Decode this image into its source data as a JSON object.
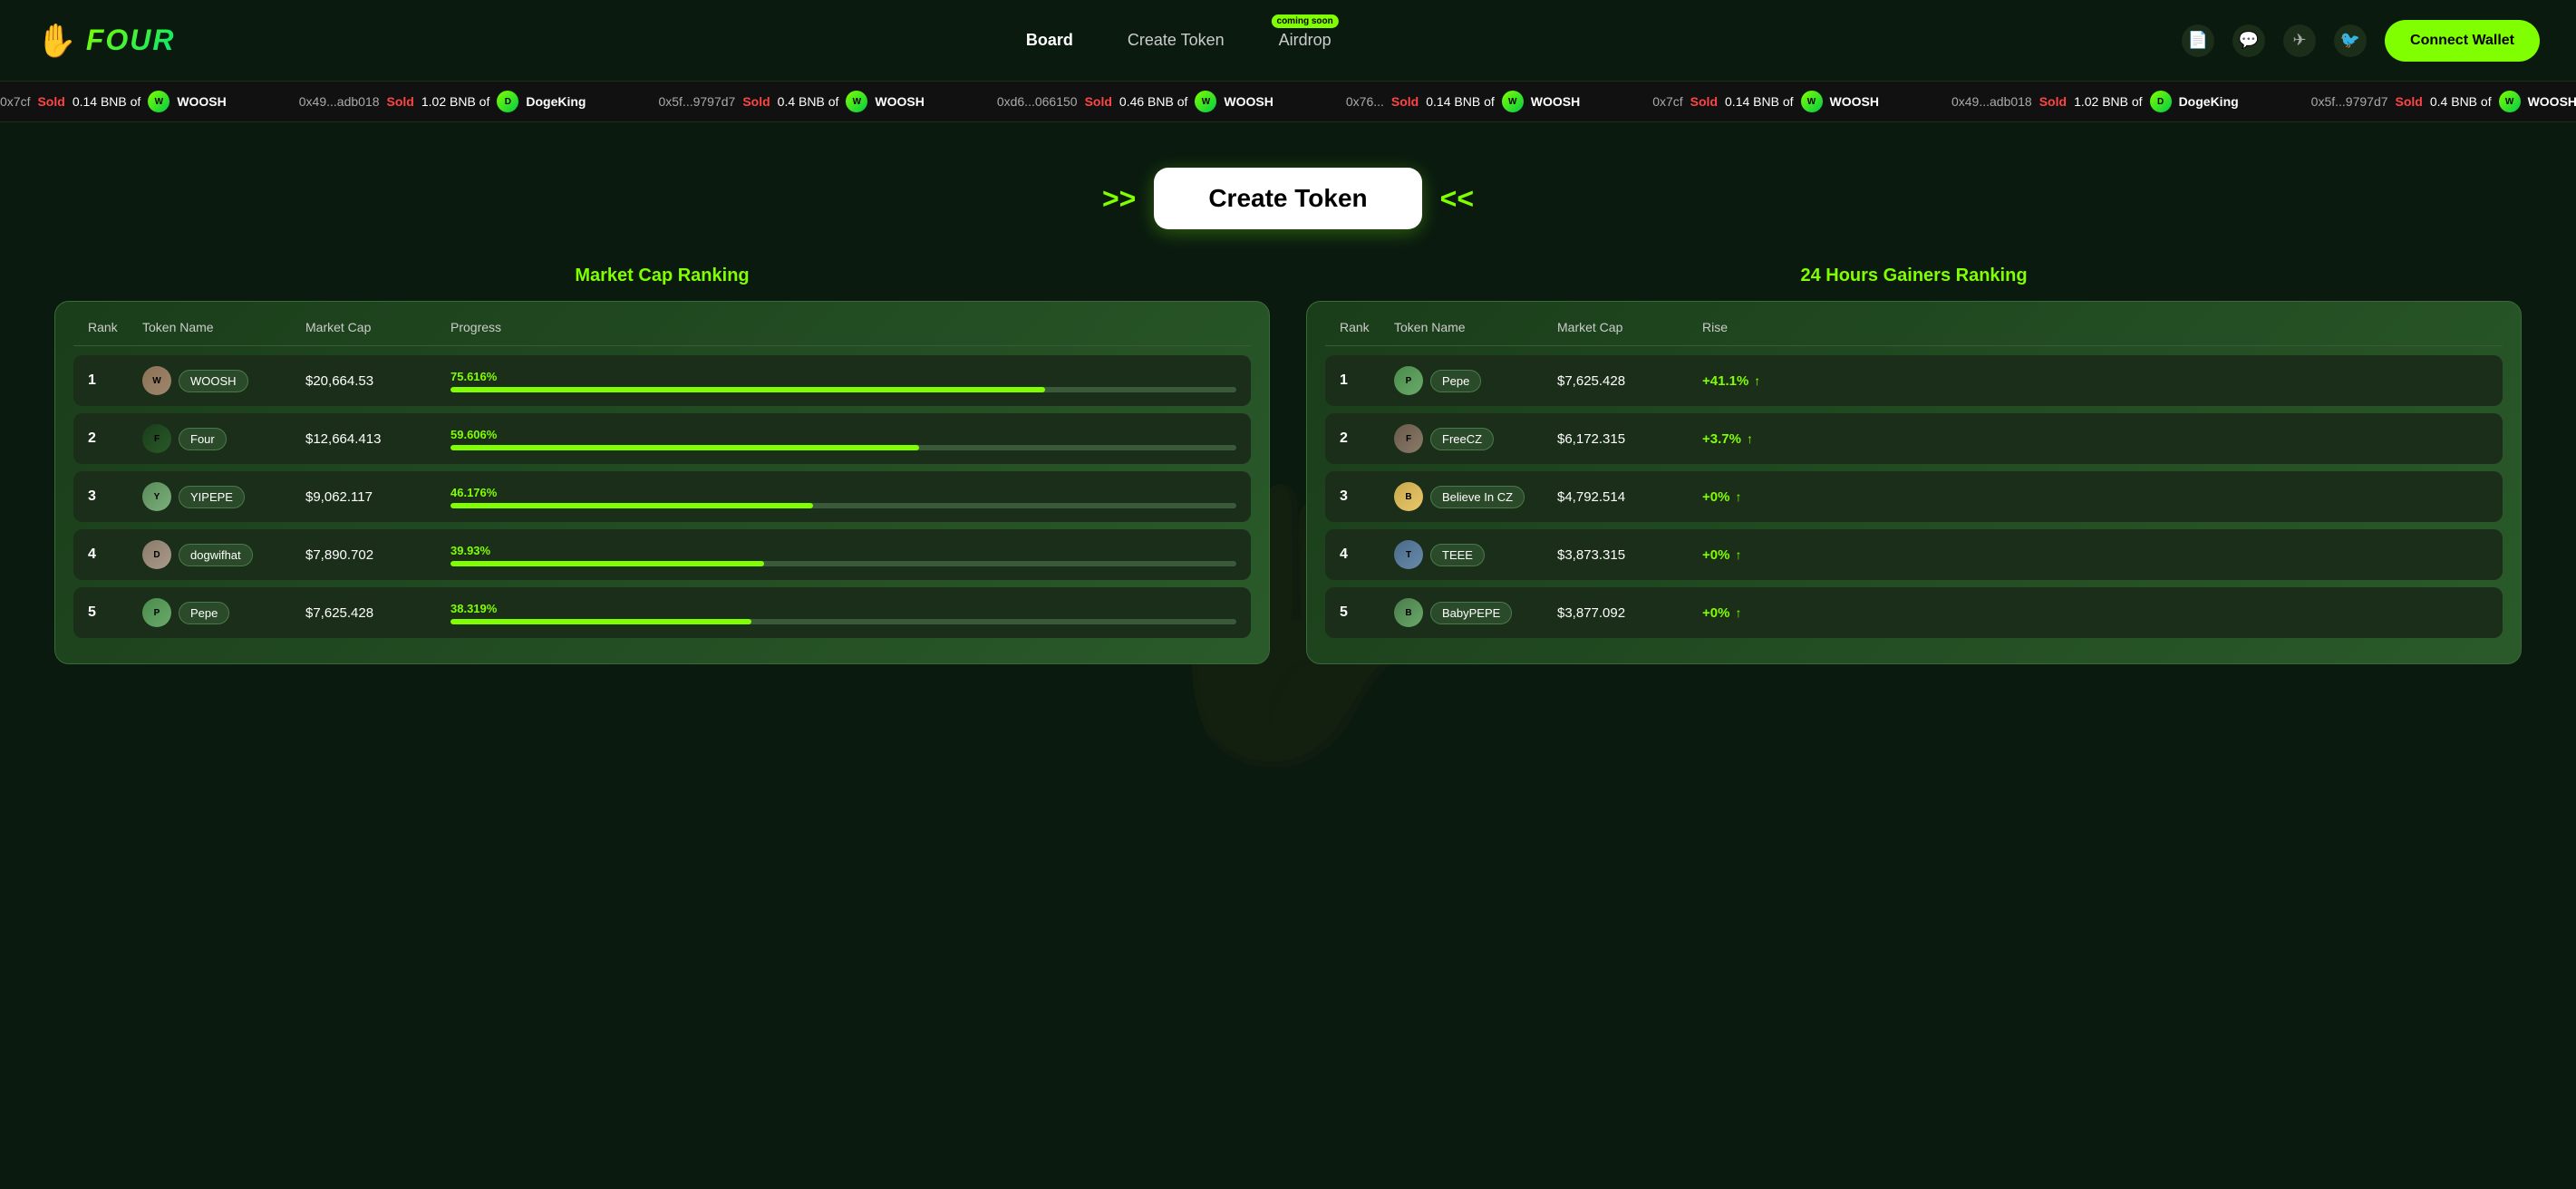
{
  "navbar": {
    "logo_icon": "✋",
    "logo_text": "FOUR",
    "nav_links": [
      {
        "id": "board",
        "label": "Board",
        "active": true
      },
      {
        "id": "create-token",
        "label": "Create Token",
        "active": false
      },
      {
        "id": "airdrop",
        "label": "Airdrop",
        "active": false,
        "badge": "coming soon"
      }
    ],
    "icons": [
      {
        "id": "docs",
        "symbol": "📄"
      },
      {
        "id": "discord",
        "symbol": "💬"
      },
      {
        "id": "telegram",
        "symbol": "✈"
      },
      {
        "id": "twitter",
        "symbol": "🐦"
      }
    ],
    "connect_wallet_label": "Connect Wallet"
  },
  "ticker": {
    "items": [
      {
        "addr": "0x7cf",
        "action": "Sold",
        "amount": "0.14 BNB of",
        "token": "WOOSH"
      },
      {
        "addr": "0x49...adb018",
        "action": "Sold",
        "amount": "1.02 BNB of",
        "token": "DogeKing"
      },
      {
        "addr": "0x5f...9797d7",
        "action": "Sold",
        "amount": "0.4 BNB of",
        "token": "WOOSH"
      },
      {
        "addr": "0xd6...066150",
        "action": "Sold",
        "amount": "0.46 BNB of",
        "token": "WOOSH"
      },
      {
        "addr": "0x76...",
        "action": "Sold",
        "amount": "0.14 BNB of",
        "token": "WOOSH"
      }
    ]
  },
  "create_token_hero": {
    "label": "Create Token",
    "chevron_left": ">>",
    "chevron_right": "<<"
  },
  "market_cap_ranking": {
    "title": "Market Cap Ranking",
    "columns": [
      "Rank",
      "Token Name",
      "Market Cap",
      "Progress"
    ],
    "rows": [
      {
        "rank": 1,
        "name": "WOOSH",
        "avatar_class": "avatar-woosh",
        "avatar_letter": "W",
        "market_cap": "$20,664.53",
        "progress_pct": "75.616%",
        "progress_val": 75.616
      },
      {
        "rank": 2,
        "name": "Four",
        "avatar_class": "avatar-four",
        "avatar_letter": "F",
        "market_cap": "$12,664.413",
        "progress_pct": "59.606%",
        "progress_val": 59.606
      },
      {
        "rank": 3,
        "name": "YIPEPE",
        "avatar_class": "avatar-yipepe",
        "avatar_letter": "Y",
        "market_cap": "$9,062.117",
        "progress_pct": "46.176%",
        "progress_val": 46.176
      },
      {
        "rank": 4,
        "name": "dogwifhat",
        "avatar_class": "avatar-dogwifhat",
        "avatar_letter": "D",
        "market_cap": "$7,890.702",
        "progress_pct": "39.93%",
        "progress_val": 39.93
      },
      {
        "rank": 5,
        "name": "Pepe",
        "avatar_class": "avatar-pepe",
        "avatar_letter": "P",
        "market_cap": "$7,625.428",
        "progress_pct": "38.319%",
        "progress_val": 38.319
      }
    ]
  },
  "gainers_ranking": {
    "title": "24 Hours Gainers Ranking",
    "columns": [
      "Rank",
      "Token Name",
      "Market Cap",
      "Rise"
    ],
    "rows": [
      {
        "rank": 1,
        "name": "Pepe",
        "avatar_class": "avatar-pepe",
        "avatar_letter": "P",
        "market_cap": "$7,625.428",
        "rise": "+41.1%",
        "rise_val": 41.1
      },
      {
        "rank": 2,
        "name": "FreeCZ",
        "avatar_class": "avatar-freecz",
        "avatar_letter": "F",
        "market_cap": "$6,172.315",
        "rise": "+3.7%",
        "rise_val": 3.7
      },
      {
        "rank": 3,
        "name": "Believe In CZ",
        "avatar_class": "avatar-believeincz",
        "avatar_letter": "B",
        "market_cap": "$4,792.514",
        "rise": "+0%",
        "rise_val": 0
      },
      {
        "rank": 4,
        "name": "TEEE",
        "avatar_class": "avatar-teee",
        "avatar_letter": "T",
        "market_cap": "$3,873.315",
        "rise": "+0%",
        "rise_val": 0
      },
      {
        "rank": 5,
        "name": "BabyPEPE",
        "avatar_class": "avatar-babypepe",
        "avatar_letter": "B",
        "market_cap": "$3,877.092",
        "rise": "+0%",
        "rise_val": 0
      }
    ]
  }
}
